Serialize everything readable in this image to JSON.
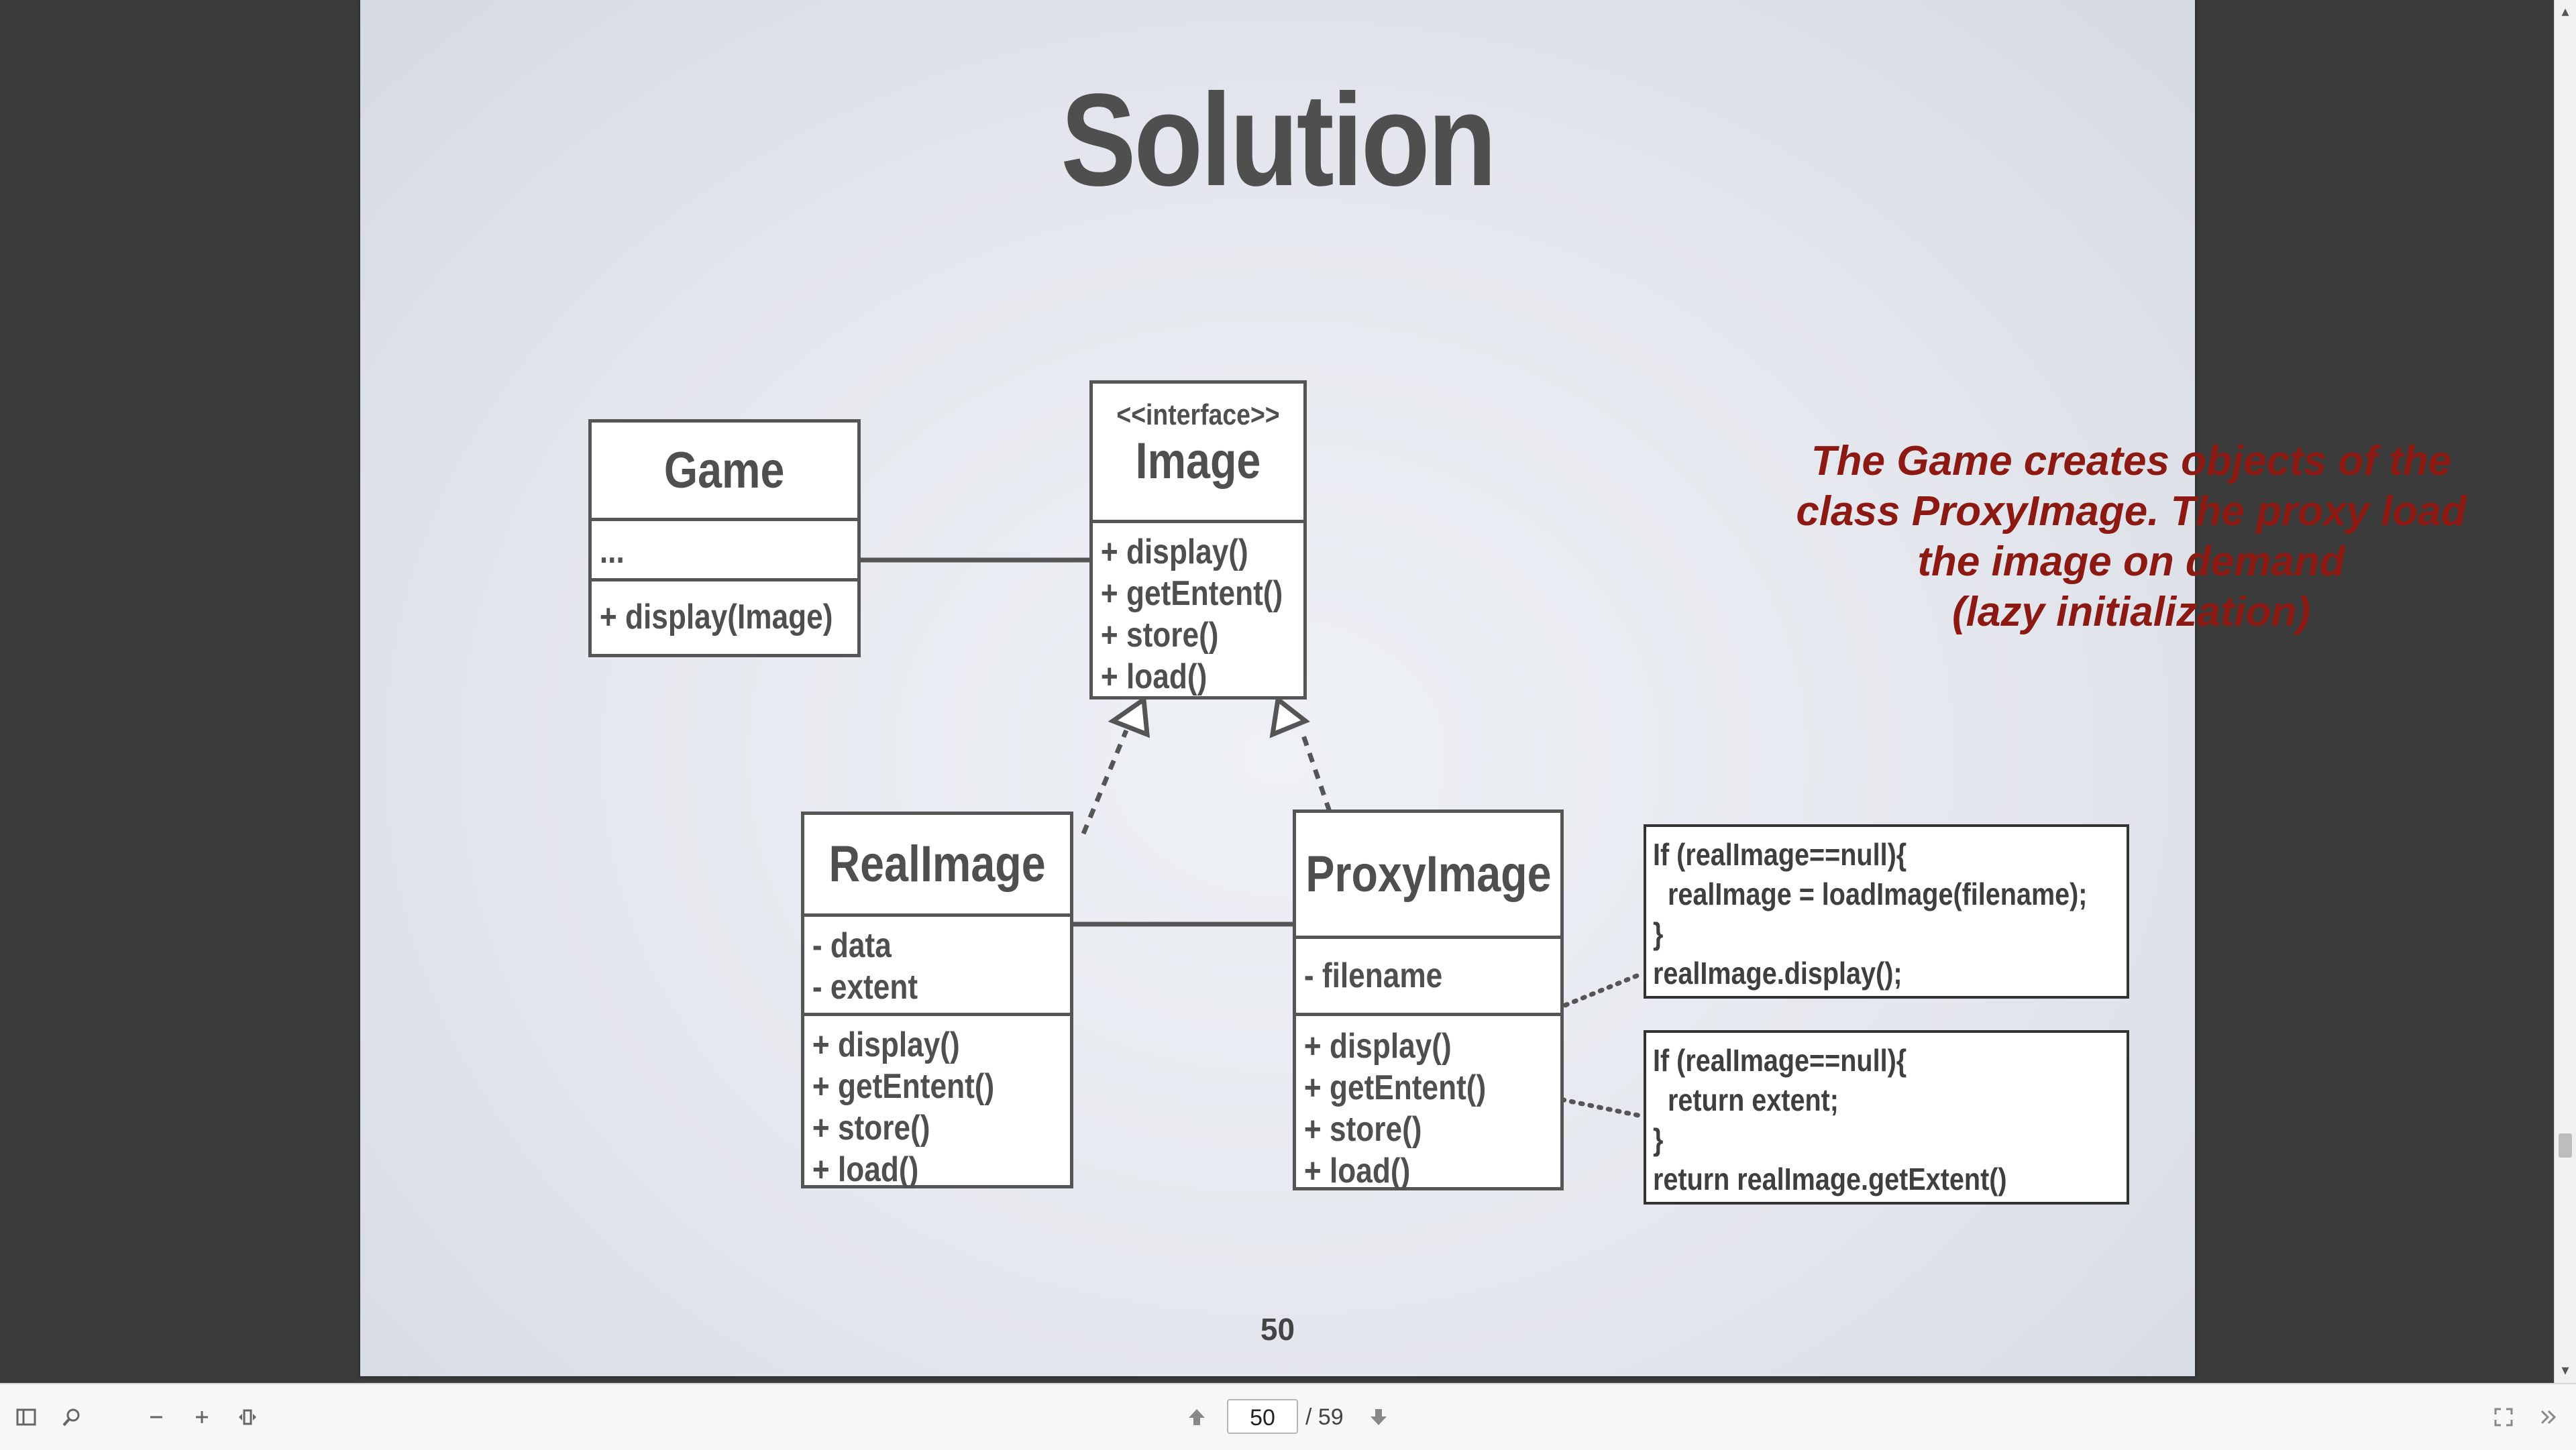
{
  "slide": {
    "title": "Solution",
    "page_number": "50",
    "annotation": [
      "The Game creates objects of the",
      "class ProxyImage. The proxy load",
      "the image on demand",
      "(lazy initialization)"
    ]
  },
  "classes": {
    "game": {
      "name": "Game",
      "attributes": [
        "..."
      ],
      "methods": [
        "+  display(Image)"
      ]
    },
    "image": {
      "stereotype": "<<interface>>",
      "name": "Image",
      "methods": [
        "+  display()",
        "+  getEntent()",
        "+  store()",
        "+  load()"
      ]
    },
    "realimage": {
      "name": "RealImage",
      "attributes": [
        "-   data",
        "-   extent"
      ],
      "methods": [
        "+  display()",
        "+  getEntent()",
        "+  store()",
        "+  load()"
      ]
    },
    "proxyimage": {
      "name": "ProxyImage",
      "attributes": [
        "- filename"
      ],
      "methods": [
        "+  display()",
        "+  getEntent()",
        "+  store()",
        "+  load()"
      ]
    }
  },
  "notes": {
    "display_note": [
      "If (realImage==null){",
      "  realImage = loadImage(filename);",
      "}",
      "realImage.display();"
    ],
    "extent_note": [
      "If (realImage==null){",
      "  return extent;",
      "}",
      "return realImage.getExtent()"
    ]
  },
  "toolbar": {
    "page_input": "50",
    "page_total": "/ 59",
    "icons": [
      "sidebar-toggle-icon",
      "search-icon",
      "zoom-out-icon",
      "zoom-in-icon",
      "fit-page-icon",
      "previous-page-icon",
      "next-page-icon",
      "fullscreen-icon",
      "more-tools-icon"
    ]
  },
  "colors": {
    "accent_red": "#8c1a12",
    "uml_text": "#4f4f4f",
    "viewer_bg": "#3b3b3b"
  }
}
